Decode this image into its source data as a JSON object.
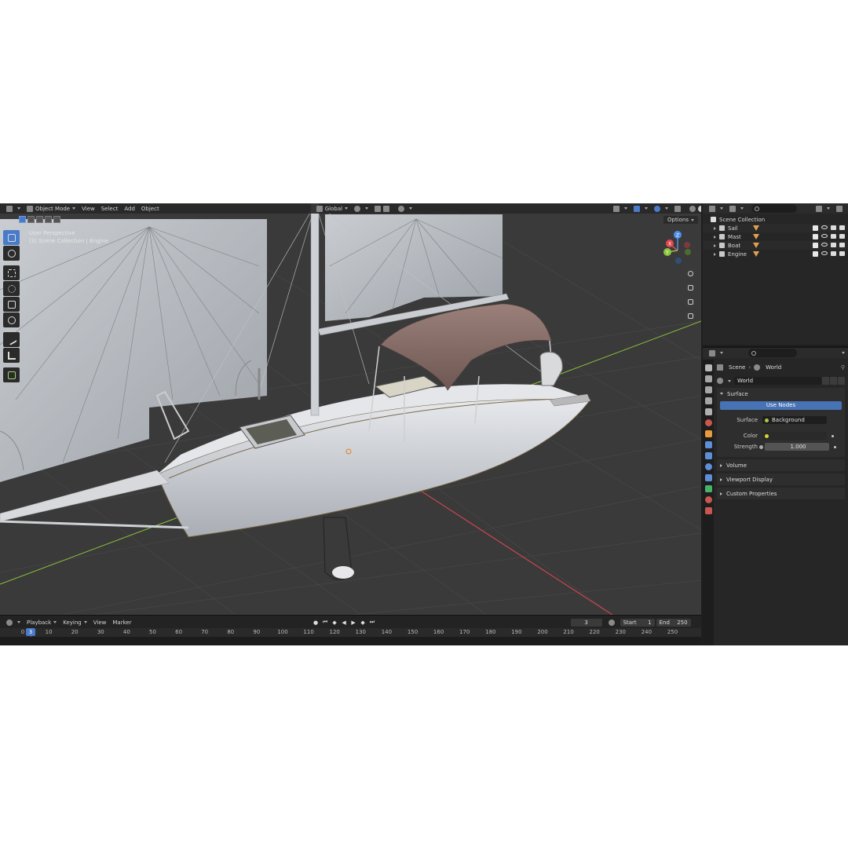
{
  "header": {
    "mode": "Object Mode",
    "menus": [
      "View",
      "Select",
      "Add",
      "Object"
    ],
    "transform_orientation": "Global"
  },
  "viewport": {
    "perspective": "User Perspective",
    "context": "(3) Scene Collection | Engine",
    "options_label": "Options",
    "gizmo": {
      "x": "X",
      "y": "Y",
      "z": "Z"
    }
  },
  "toolbar": {
    "tools": [
      "select-box-icon",
      "cursor-icon",
      "move-icon",
      "rotate-icon",
      "scale-icon",
      "transform-icon",
      "annotate-icon",
      "measure-icon",
      "add-cube-icon"
    ]
  },
  "outliner": {
    "root": "Scene Collection",
    "items": [
      {
        "label": "Sail"
      },
      {
        "label": "Mast"
      },
      {
        "label": "Boat"
      },
      {
        "label": "Engine"
      }
    ]
  },
  "properties": {
    "breadcrumb": {
      "scene": "Scene",
      "world": "World"
    },
    "world_name": "World",
    "surface": {
      "title": "Surface",
      "use_nodes": "Use Nodes",
      "surface_label": "Surface",
      "surface_value": "Background",
      "color_label": "Color",
      "strength_label": "Strength",
      "strength_value": "1.000"
    },
    "panels": [
      "Volume",
      "Viewport Display",
      "Custom Properties"
    ]
  },
  "timeline": {
    "menus": [
      "Playback",
      "Keying",
      "View",
      "Marker"
    ],
    "current_frame": "3",
    "start_label": "Start",
    "start_value": "1",
    "end_label": "End",
    "end_value": "250",
    "ticks": [
      "0",
      "10",
      "20",
      "30",
      "40",
      "50",
      "60",
      "70",
      "80",
      "90",
      "100",
      "110",
      "120",
      "130",
      "140",
      "150",
      "160",
      "170",
      "180",
      "190",
      "200",
      "210",
      "220",
      "230",
      "240",
      "250"
    ]
  },
  "colors": {
    "accent": "#4a7bc8",
    "axis_x": "#e54650",
    "axis_y": "#8cc43c",
    "axis_z": "#4f8ee8",
    "canopy": "#8a6f66",
    "hull": "#dcdfe4"
  }
}
